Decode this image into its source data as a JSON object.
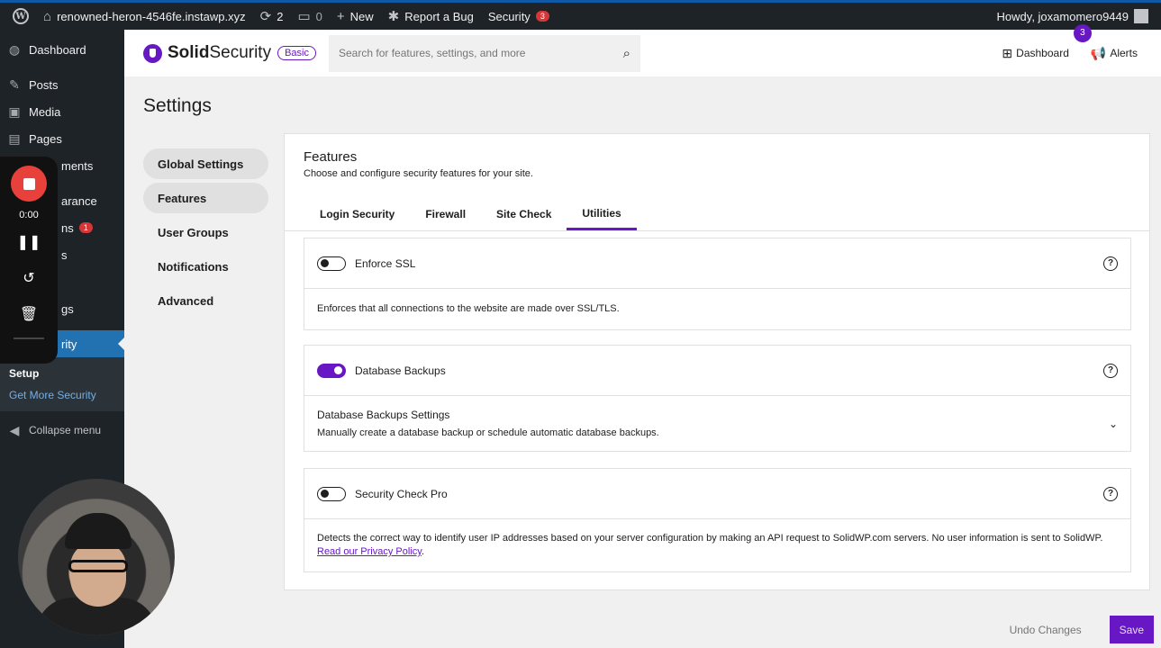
{
  "admin_bar": {
    "site_name": "renowned-heron-4546fe.instawp.xyz",
    "updates_count": "2",
    "comments_count": "0",
    "new_label": "New",
    "report_bug_label": "Report a Bug",
    "security_label": "Security",
    "security_count": "3",
    "howdy": "Howdy, joxamomero9449"
  },
  "sidebar": {
    "items": [
      {
        "label": "Dashboard",
        "icon": "dashboard-icon"
      },
      {
        "label": "Posts",
        "icon": "pin-icon"
      },
      {
        "label": "Media",
        "icon": "media-icon"
      },
      {
        "label": "Pages",
        "icon": "pages-icon"
      },
      {
        "label": "ments",
        "icon": "comments-icon"
      },
      {
        "label": "arance",
        "icon": "appearance-icon"
      },
      {
        "label": "ns",
        "icon": "plugins-icon",
        "badge": "1"
      },
      {
        "label": "s",
        "icon": "users-icon"
      },
      {
        "label": "",
        "icon": "tools-icon"
      },
      {
        "label": "gs",
        "icon": "settings-icon"
      },
      {
        "label": "rity",
        "icon": "security-icon"
      }
    ],
    "submenu": [
      "Setup",
      "Get More Security"
    ],
    "collapse_label": "Collapse menu"
  },
  "recorder": {
    "time": "0:00"
  },
  "header": {
    "brand_bold": "Solid",
    "brand_light": "Security",
    "plan_badge": "Basic",
    "search_placeholder": "Search for features, settings, and more",
    "dashboard_label": "Dashboard",
    "alerts_label": "Alerts",
    "alerts_count": "3"
  },
  "page_title": "Settings",
  "settings_nav": [
    "Global Settings",
    "Features",
    "User Groups",
    "Notifications",
    "Advanced"
  ],
  "panel": {
    "title": "Features",
    "description": "Choose and configure security features for your site.",
    "tabs": [
      "Login Security",
      "Firewall",
      "Site Check",
      "Utilities"
    ],
    "selected_tab": "Utilities",
    "features": [
      {
        "name": "Enforce SSL",
        "enabled": false,
        "description": "Enforces that all connections to the website are made over SSL/TLS."
      },
      {
        "name": "Database Backups",
        "enabled": true,
        "settings_title": "Database Backups Settings",
        "settings_description": "Manually create a database backup or schedule automatic database backups."
      },
      {
        "name": "Security Check Pro",
        "enabled": false,
        "description": "Detects the correct way to identify user IP addresses based on your server configuration by making an API request to SolidWP.com servers. No user information is sent to SolidWP.",
        "link": "Read our Privacy Policy"
      }
    ]
  },
  "footer": {
    "undo_label": "Undo Changes",
    "save_label": "Save"
  },
  "colors": {
    "accent": "#6817c5",
    "admin_bg": "#1d2327",
    "wp_blue": "#2271b1"
  }
}
